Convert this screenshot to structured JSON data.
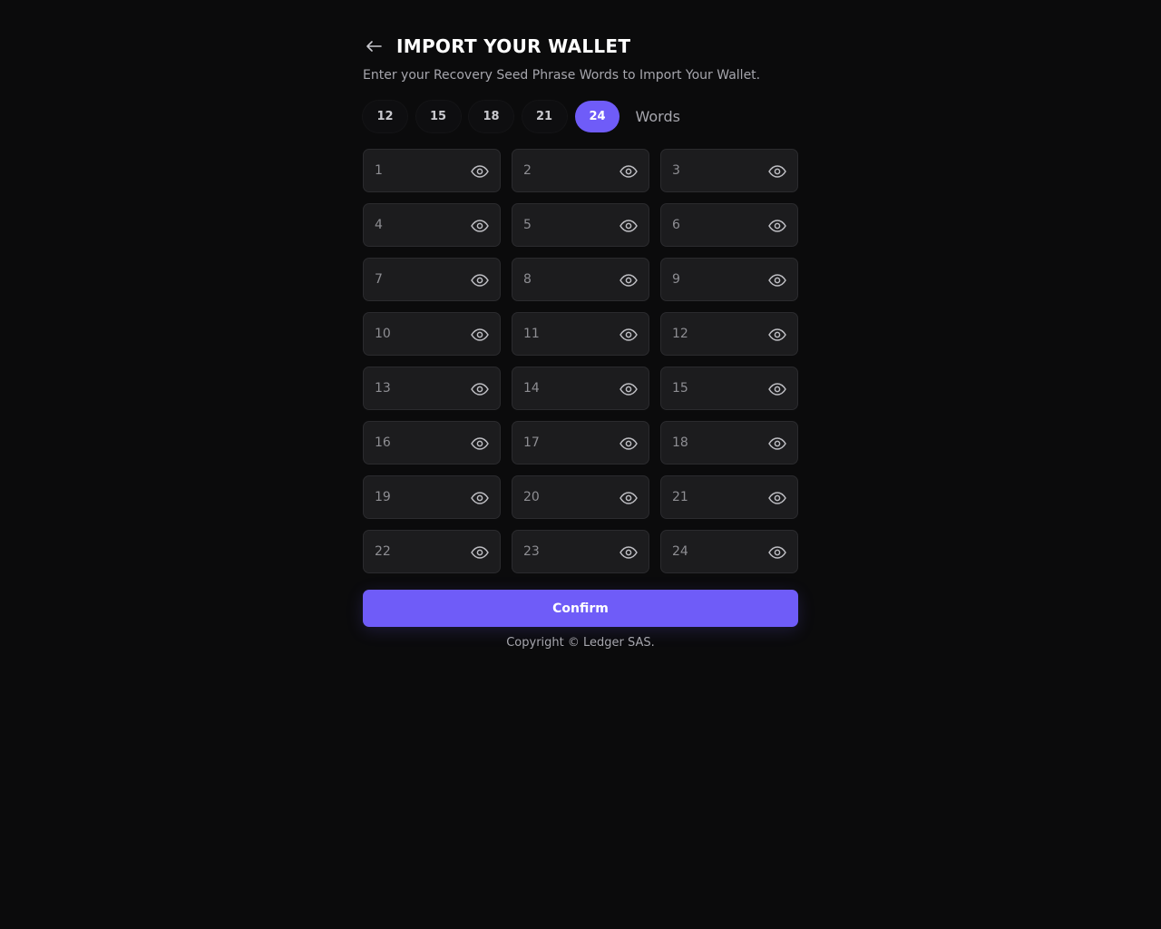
{
  "header": {
    "title": "IMPORT YOUR WALLET",
    "back_icon": "arrow-left-icon"
  },
  "subtitle": "Enter your Recovery Seed Phrase Words to Import Your Wallet.",
  "word_count": {
    "options": [
      "12",
      "15",
      "18",
      "21",
      "24"
    ],
    "selected": "24",
    "label": "Words"
  },
  "fields": {
    "eye_icon": "eye-icon",
    "placeholders": [
      "1",
      "2",
      "3",
      "4",
      "5",
      "6",
      "7",
      "8",
      "9",
      "10",
      "11",
      "12",
      "13",
      "14",
      "15",
      "16",
      "17",
      "18",
      "19",
      "20",
      "21",
      "22",
      "23",
      "24"
    ]
  },
  "confirm_label": "Confirm",
  "footer": "Copyright © Ledger SAS.",
  "colors": {
    "accent": "#6f5cf8",
    "background": "#0b0b0c",
    "field_bg": "#1c1c1e"
  }
}
